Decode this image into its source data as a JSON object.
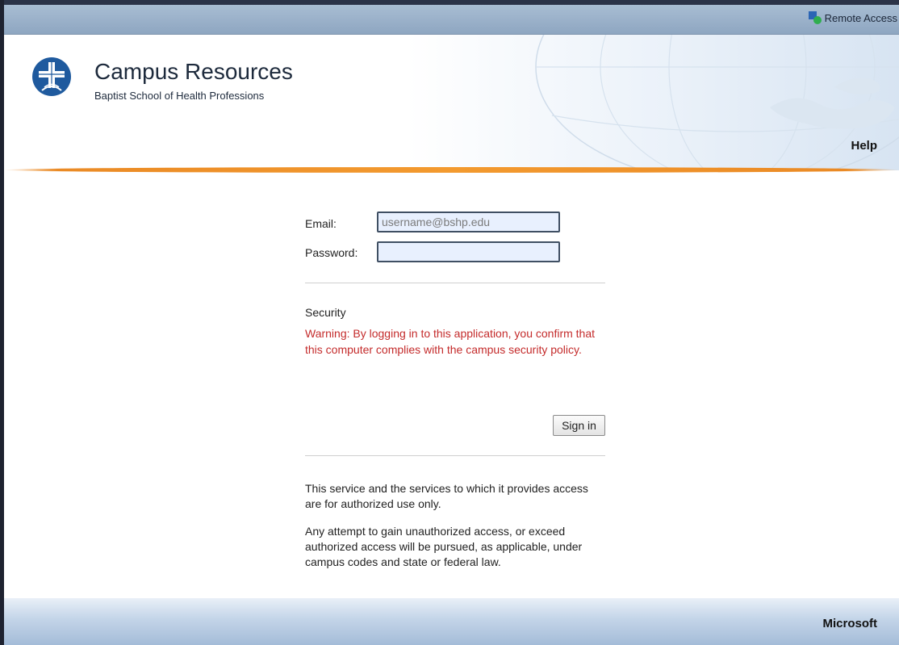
{
  "header": {
    "remote_access_label": "Remote Access"
  },
  "banner": {
    "title": "Campus Resources",
    "subtitle": "Baptist School of Health Professions",
    "help_label": "Help"
  },
  "form": {
    "email_label": "Email:",
    "email_placeholder": "username@bshp.edu",
    "email_value": "",
    "password_label": "Password:",
    "password_value": "",
    "security_heading": "Security",
    "security_warning": "Warning: By logging in to this application, you confirm that this computer complies with the campus security policy.",
    "signin_label": "Sign in"
  },
  "notices": {
    "authorized_use": "This service and the services to which it provides access are for authorized use only.",
    "unauthorized_access": "Any attempt to gain unauthorized access, or exceed authorized access will be pursued, as applicable, under campus codes and state or federal law."
  },
  "footer": {
    "brand": "Microsoft"
  },
  "colors": {
    "accent_orange": "#f39a2f",
    "warning_red": "#c42b2b",
    "logo_blue": "#1f5a9e",
    "header_blue": "#9bb2cb"
  },
  "icons": {
    "remote_access": "remote-access-icon",
    "logo": "cross-logo-icon"
  }
}
